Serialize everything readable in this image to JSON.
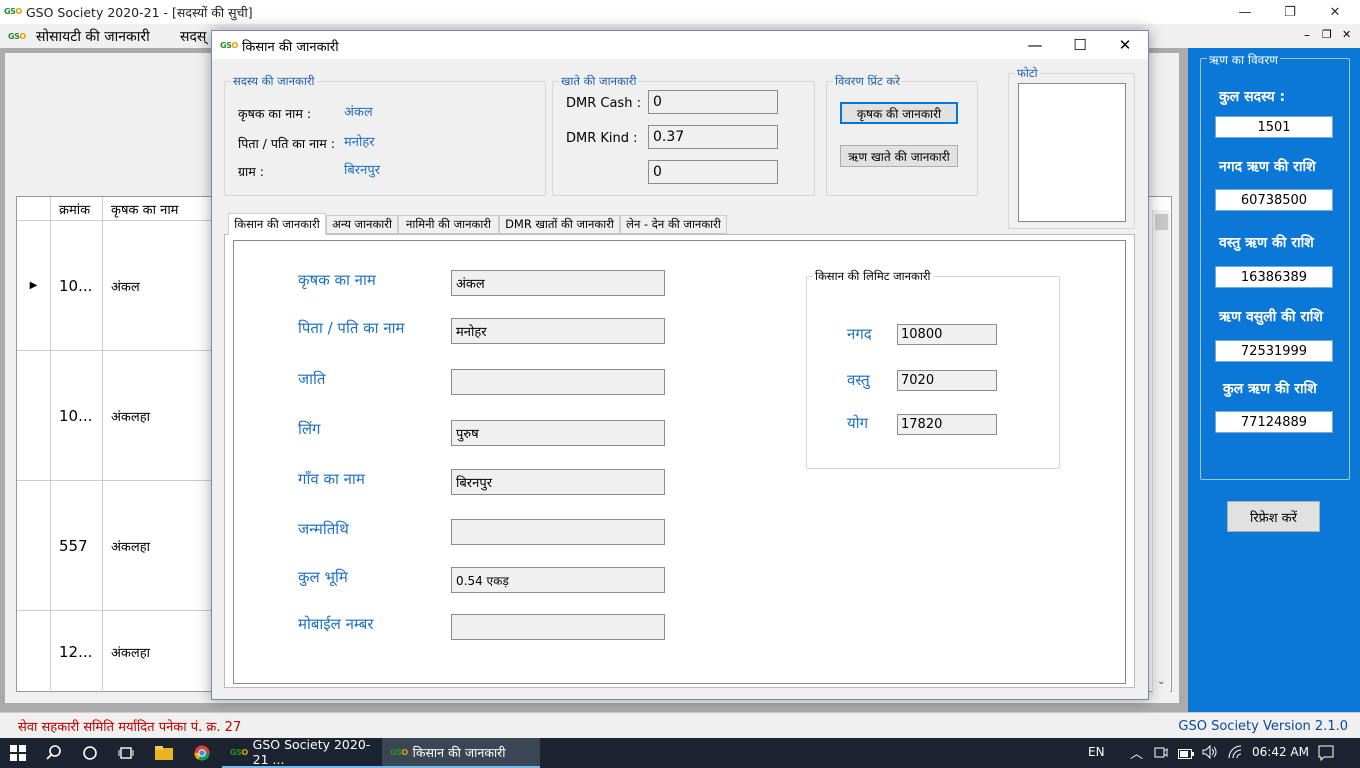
{
  "main_window": {
    "title": "GSO Society 2020-21 - [सदस्यों की सुची]",
    "menu": [
      "सोसायटी की जानकारी",
      "सदस्"
    ],
    "controls": {
      "minimize": "—",
      "maximize": "❐",
      "close": "✕"
    },
    "mdi_controls": {
      "minimize": "–",
      "restore": "❐",
      "close": "✕"
    }
  },
  "grid": {
    "columns": [
      "क्रमांक",
      "कृषक का नाम"
    ],
    "rows": [
      {
        "id": "10...",
        "name": "अंकल",
        "selected": true
      },
      {
        "id": "10...",
        "name": "अंकलहा",
        "selected": false
      },
      {
        "id": "557",
        "name": "अंकलहा",
        "selected": false
      },
      {
        "id": "12...",
        "name": "अंकलहा",
        "selected": false
      }
    ],
    "row_indicator": "▶"
  },
  "loan_panel": {
    "legend": "ऋण का विवरण",
    "items": [
      {
        "label": "कुल सदस्य :",
        "value": "1501"
      },
      {
        "label": "नगद ऋण की राशि",
        "value": "60738500"
      },
      {
        "label": "वस्तु ऋण की राशि",
        "value": "16386389"
      },
      {
        "label": "ऋण वसुली की राशि",
        "value": "72531999"
      },
      {
        "label": "कुल ऋण की राशि",
        "value": "77124889"
      }
    ],
    "refresh_label": "रिफ्रेश करें"
  },
  "statusbar": {
    "left": "सेवा सहकारी समिति मर्यादित पनेका पं. क्र. 27",
    "right": "GSO Society Version 2.1.0"
  },
  "dialog": {
    "title": "किसान की जानकारी",
    "member_group": {
      "legend": "सदस्य की जानकारी",
      "fields": [
        {
          "label": "कृषक का नाम :",
          "value": "अंकल"
        },
        {
          "label": "पिता / पति का नाम :",
          "value": "मनोहर"
        },
        {
          "label": "ग्राम :",
          "value": "बिरनपुर"
        }
      ]
    },
    "account_group": {
      "legend": "खाते  की जानकारी",
      "fields": [
        {
          "label": "DMR Cash :",
          "value": "0"
        },
        {
          "label": "DMR Kind :",
          "value": "0.37"
        },
        {
          "label": "",
          "value": "0"
        }
      ]
    },
    "print_group": {
      "legend": "विवरण प्रिंट करे",
      "farmer_info_button": "कृषक की जानकारी",
      "loan_account_button": "ऋण खाते की जानकारी"
    },
    "photo_legend": "फोटो",
    "tabs": [
      "किसान की जानकारी",
      "अन्य जानकारी",
      "नामिनी की जानकारी",
      "DMR खातों की जानकारी",
      "लेन - देन की जानकारी"
    ],
    "farmer_form": [
      {
        "label": "कृषक का नाम",
        "value": "अंकल"
      },
      {
        "label": "पिता / पति का नाम",
        "value": "मनोहर"
      },
      {
        "label": "जाति",
        "value": ""
      },
      {
        "label": "लिंग",
        "value": "पुरुष"
      },
      {
        "label": "गाँव का नाम",
        "value": "बिरनपुर"
      },
      {
        "label": "जन्मतिथि",
        "value": ""
      },
      {
        "label": "कुल भूमि",
        "value": "0.54 एकड़"
      },
      {
        "label": "मोबाईल नम्बर",
        "value": ""
      }
    ],
    "limit_group": {
      "legend": "किसान की लिमिट जानकारी",
      "fields": [
        {
          "label": "नगद",
          "value": "10800"
        },
        {
          "label": "वस्तु",
          "value": "7020"
        },
        {
          "label": "योग",
          "value": "17820"
        }
      ]
    }
  },
  "taskbar": {
    "apps": [
      {
        "label": "GSO Society 2020-21 ...",
        "active": false
      },
      {
        "label": "किसान की जानकारी",
        "active": true
      }
    ],
    "language": "EN",
    "time": "06:42 AM"
  },
  "colors": {
    "accent_blue": "#0b78d7",
    "label_blue": "#1e6fc7",
    "status_red": "#c00000"
  }
}
